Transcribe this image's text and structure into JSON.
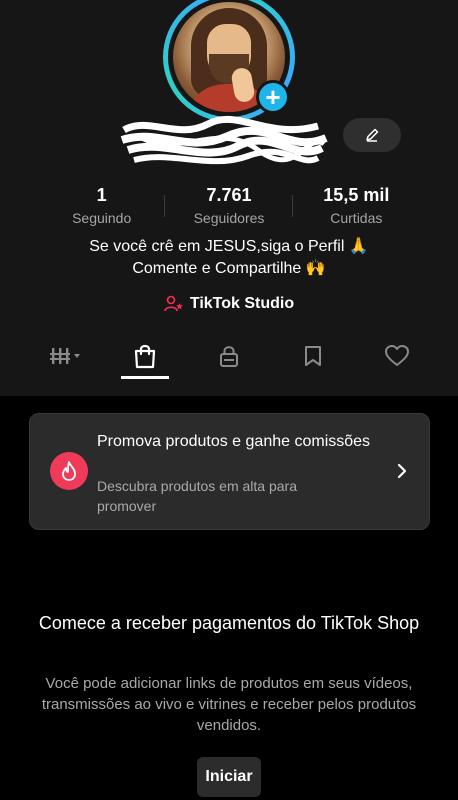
{
  "profile": {
    "stats": [
      {
        "value": "1",
        "label": "Seguindo"
      },
      {
        "value": "7.761",
        "label": "Seguidores"
      },
      {
        "value": "15,5 mil",
        "label": "Curtidas"
      }
    ],
    "bio_line1": "Se você crê em JESUS,siga o Perfil 🙏",
    "bio_line2": "Comente e Compartilhe 🙌",
    "studio_label": "TikTok Studio"
  },
  "tabs": [
    {
      "icon": "grid-icon"
    },
    {
      "icon": "shopping-bag-icon",
      "active": true
    },
    {
      "icon": "lock-icon"
    },
    {
      "icon": "bookmark-icon"
    },
    {
      "icon": "heart-icon"
    }
  ],
  "promo": {
    "title": "Promova produtos e ganhe comissões",
    "subtitle": "Descubra produtos em alta para promover"
  },
  "shop": {
    "title": "Comece a receber pagamentos do TikTok Shop",
    "description": "Você pode adicionar links de produtos em seus vídeos, transmissões ao vivo e vitrines e receber pelos produtos vendidos.",
    "start_label": "Iniciar"
  },
  "colors": {
    "accent_ring": "#2ed3c8",
    "add_button": "#20b5e9",
    "promo_icon": "#ef3b59",
    "studio_icon": "#fe2c55"
  }
}
